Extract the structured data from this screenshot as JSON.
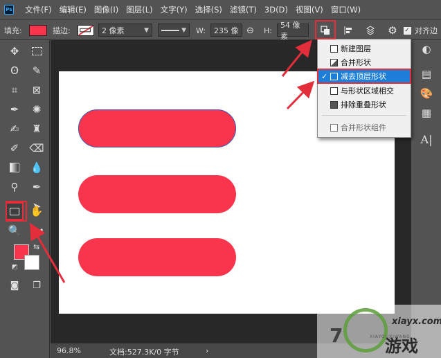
{
  "app": {
    "logo_text": "Ps"
  },
  "menubar": {
    "items": [
      "文件(F)",
      "编辑(E)",
      "图像(I)",
      "图层(L)",
      "文字(Y)",
      "选择(S)",
      "滤镜(T)",
      "3D(D)",
      "视图(V)",
      "窗口(W)"
    ]
  },
  "options": {
    "fill_label": "填充:",
    "fill_color": "#f8354d",
    "stroke_label": "描边:",
    "stroke_width": "2 像素",
    "w_label": "W:",
    "w_value": "235 像",
    "link_icon": "link-icon",
    "h_label": "H:",
    "h_value": "54 像素",
    "align_edges_label": "对齐边"
  },
  "dropdown": {
    "items": [
      {
        "label": "新建图层",
        "checked": false,
        "disabled": false
      },
      {
        "label": "合并形状",
        "checked": false,
        "disabled": false
      },
      {
        "label": "减去顶层形状",
        "checked": true,
        "disabled": false
      },
      {
        "label": "与形状区域相交",
        "checked": false,
        "disabled": false
      },
      {
        "label": "排除重叠形状",
        "checked": false,
        "disabled": false
      },
      {
        "label": "合并形状组件",
        "checked": false,
        "disabled": true
      }
    ],
    "check_mark": "✓"
  },
  "status": {
    "zoom": "96.8%",
    "doc_info": "文档:527.3K/0 字节",
    "arrow": "›"
  },
  "watermark": {
    "num": "7",
    "brand": "游戏",
    "site": "xiayx.com",
    "domain": "XIAYOUXIWANG"
  },
  "colors": {
    "accent_red": "#e22d3a",
    "shape_fill": "#f8354d",
    "menu_highlight": "#1d7fd8"
  }
}
